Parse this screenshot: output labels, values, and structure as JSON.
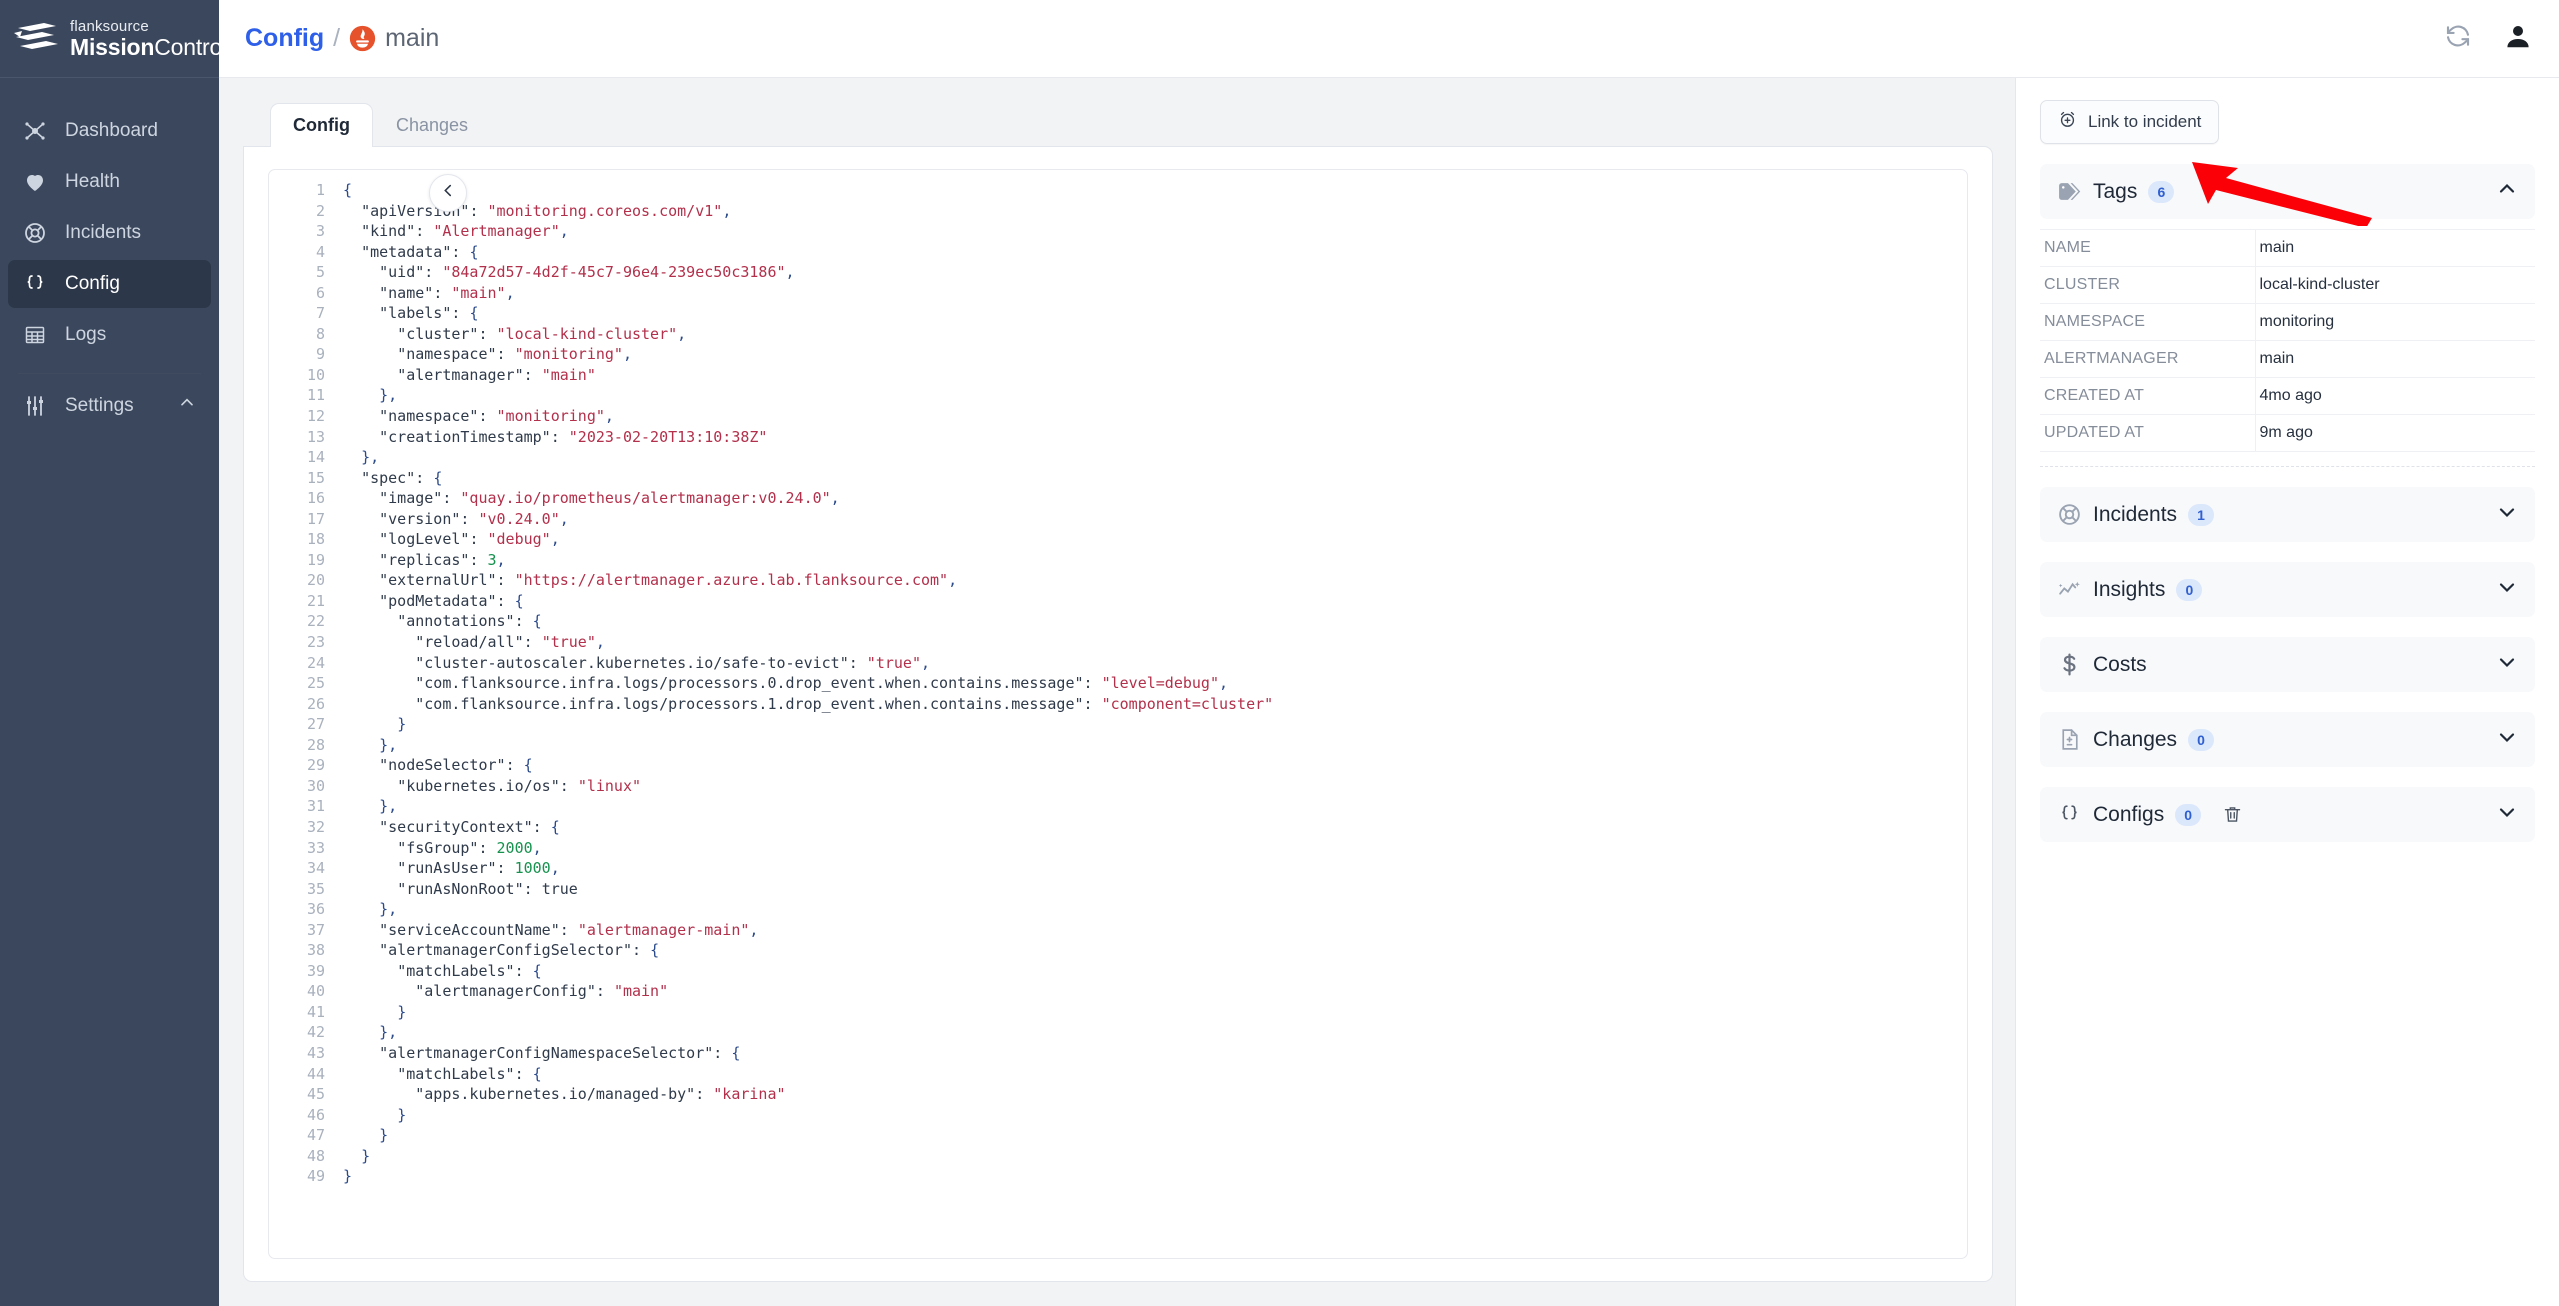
{
  "sidebar": {
    "logo": {
      "top": "flanksource",
      "bold": "Mission",
      "light": "Control",
      "icon": "flanksource-logo-icon"
    },
    "items": [
      {
        "label": "Dashboard",
        "icon": "topology-icon",
        "active": false
      },
      {
        "label": "Health",
        "icon": "heart-icon",
        "active": false
      },
      {
        "label": "Incidents",
        "icon": "lifebuoy-icon",
        "active": false
      },
      {
        "label": "Config",
        "icon": "braces-icon",
        "active": true
      },
      {
        "label": "Logs",
        "icon": "table-icon",
        "active": false
      }
    ],
    "settings": {
      "label": "Settings",
      "icon": "sliders-icon",
      "chevron": "chevron-up-icon"
    }
  },
  "header": {
    "breadcrumb_root": "Config",
    "breadcrumb_separator": "/",
    "breadcrumb_current": "main",
    "breadcrumb_icon": "prometheus-icon",
    "refresh_icon": "refresh-icon",
    "user_icon": "user-avatar-icon"
  },
  "content": {
    "collapse_icon": "chevron-left-icon",
    "tabs": [
      {
        "label": "Config",
        "active": true
      },
      {
        "label": "Changes",
        "active": false
      }
    ],
    "code_lines": [
      {
        "n": 1,
        "html": "<span class='k-brace'>{</span>"
      },
      {
        "n": 2,
        "html": "  <span class='k-key'>\"apiVersion\"</span>: <span class='k-str'>\"monitoring.coreos.com/v1\"</span><span class='k-punc'>,</span>"
      },
      {
        "n": 3,
        "html": "  <span class='k-key'>\"kind\"</span>: <span class='k-str'>\"Alertmanager\"</span><span class='k-punc'>,</span>"
      },
      {
        "n": 4,
        "html": "  <span class='k-key'>\"metadata\"</span>: <span class='k-brace'>{</span>"
      },
      {
        "n": 5,
        "html": "    <span class='k-key'>\"uid\"</span>: <span class='k-str'>\"84a72d57-4d2f-45c7-96e4-239ec50c3186\"</span><span class='k-punc'>,</span>"
      },
      {
        "n": 6,
        "html": "    <span class='k-key'>\"name\"</span>: <span class='k-str'>\"main\"</span><span class='k-punc'>,</span>"
      },
      {
        "n": 7,
        "html": "    <span class='k-key'>\"labels\"</span>: <span class='k-brace'>{</span>"
      },
      {
        "n": 8,
        "html": "      <span class='k-key'>\"cluster\"</span>: <span class='k-str'>\"local-kind-cluster\"</span><span class='k-punc'>,</span>"
      },
      {
        "n": 9,
        "html": "      <span class='k-key'>\"namespace\"</span>: <span class='k-str'>\"monitoring\"</span><span class='k-punc'>,</span>"
      },
      {
        "n": 10,
        "html": "      <span class='k-key'>\"alertmanager\"</span>: <span class='k-str'>\"main\"</span>"
      },
      {
        "n": 11,
        "html": "    <span class='k-brace'>}</span><span class='k-punc'>,</span>"
      },
      {
        "n": 12,
        "html": "    <span class='k-key'>\"namespace\"</span>: <span class='k-str'>\"monitoring\"</span><span class='k-punc'>,</span>"
      },
      {
        "n": 13,
        "html": "    <span class='k-key'>\"creationTimestamp\"</span>: <span class='k-str'>\"2023-02-20T13:10:38Z\"</span>"
      },
      {
        "n": 14,
        "html": "  <span class='k-brace'>}</span><span class='k-punc'>,</span>"
      },
      {
        "n": 15,
        "html": "  <span class='k-key'>\"spec\"</span>: <span class='k-brace'>{</span>"
      },
      {
        "n": 16,
        "html": "    <span class='k-key'>\"image\"</span>: <span class='k-str'>\"quay.io/prometheus/alertmanager:v0.24.0\"</span><span class='k-punc'>,</span>"
      },
      {
        "n": 17,
        "html": "    <span class='k-key'>\"version\"</span>: <span class='k-str'>\"v0.24.0\"</span><span class='k-punc'>,</span>"
      },
      {
        "n": 18,
        "html": "    <span class='k-key'>\"logLevel\"</span>: <span class='k-str'>\"debug\"</span><span class='k-punc'>,</span>"
      },
      {
        "n": 19,
        "html": "    <span class='k-key'>\"replicas\"</span>: <span class='k-num'>3</span><span class='k-punc'>,</span>"
      },
      {
        "n": 20,
        "html": "    <span class='k-key'>\"externalUrl\"</span>: <span class='k-str'>\"https://alertmanager.azure.lab.flanksource.com\"</span><span class='k-punc'>,</span>"
      },
      {
        "n": 21,
        "html": "    <span class='k-key'>\"podMetadata\"</span>: <span class='k-brace'>{</span>"
      },
      {
        "n": 22,
        "html": "      <span class='k-key'>\"annotations\"</span>: <span class='k-brace'>{</span>"
      },
      {
        "n": 23,
        "html": "        <span class='k-key'>\"reload/all\"</span>: <span class='k-str'>\"true\"</span><span class='k-punc'>,</span>"
      },
      {
        "n": 24,
        "html": "        <span class='k-key'>\"cluster-autoscaler.kubernetes.io/safe-to-evict\"</span>: <span class='k-str'>\"true\"</span><span class='k-punc'>,</span>"
      },
      {
        "n": 25,
        "html": "        <span class='k-key'>\"com.flanksource.infra.logs/processors.0.drop_event.when.contains.message\"</span>: <span class='k-str'>\"level=debug\"</span><span class='k-punc'>,</span>"
      },
      {
        "n": 26,
        "html": "        <span class='k-key'>\"com.flanksource.infra.logs/processors.1.drop_event.when.contains.message\"</span>: <span class='k-str'>\"component=cluster\"</span>"
      },
      {
        "n": 27,
        "html": "      <span class='k-brace'>}</span>"
      },
      {
        "n": 28,
        "html": "    <span class='k-brace'>}</span><span class='k-punc'>,</span>"
      },
      {
        "n": 29,
        "html": "    <span class='k-key'>\"nodeSelector\"</span>: <span class='k-brace'>{</span>"
      },
      {
        "n": 30,
        "html": "      <span class='k-key'>\"kubernetes.io/os\"</span>: <span class='k-str'>\"linux\"</span>"
      },
      {
        "n": 31,
        "html": "    <span class='k-brace'>}</span><span class='k-punc'>,</span>"
      },
      {
        "n": 32,
        "html": "    <span class='k-key'>\"securityContext\"</span>: <span class='k-brace'>{</span>"
      },
      {
        "n": 33,
        "html": "      <span class='k-key'>\"fsGroup\"</span>: <span class='k-num'>2000</span><span class='k-punc'>,</span>"
      },
      {
        "n": 34,
        "html": "      <span class='k-key'>\"runAsUser\"</span>: <span class='k-num'>1000</span><span class='k-punc'>,</span>"
      },
      {
        "n": 35,
        "html": "      <span class='k-key'>\"runAsNonRoot\"</span>: <span class='k-bool'>true</span>"
      },
      {
        "n": 36,
        "html": "    <span class='k-brace'>}</span><span class='k-punc'>,</span>"
      },
      {
        "n": 37,
        "html": "    <span class='k-key'>\"serviceAccountName\"</span>: <span class='k-str'>\"alertmanager-main\"</span><span class='k-punc'>,</span>"
      },
      {
        "n": 38,
        "html": "    <span class='k-key'>\"alertmanagerConfigSelector\"</span>: <span class='k-brace'>{</span>"
      },
      {
        "n": 39,
        "html": "      <span class='k-key'>\"matchLabels\"</span>: <span class='k-brace'>{</span>"
      },
      {
        "n": 40,
        "html": "        <span class='k-key'>\"alertmanagerConfig\"</span>: <span class='k-str'>\"main\"</span>"
      },
      {
        "n": 41,
        "html": "      <span class='k-brace'>}</span>"
      },
      {
        "n": 42,
        "html": "    <span class='k-brace'>}</span><span class='k-punc'>,</span>"
      },
      {
        "n": 43,
        "html": "    <span class='k-key'>\"alertmanagerConfigNamespaceSelector\"</span>: <span class='k-brace'>{</span>"
      },
      {
        "n": 44,
        "html": "      <span class='k-key'>\"matchLabels\"</span>: <span class='k-brace'>{</span>"
      },
      {
        "n": 45,
        "html": "        <span class='k-key'>\"apps.kubernetes.io/managed-by\"</span>: <span class='k-str'>\"karina\"</span>"
      },
      {
        "n": 46,
        "html": "      <span class='k-brace'>}</span>"
      },
      {
        "n": 47,
        "html": "    <span class='k-brace'>}</span>"
      },
      {
        "n": 48,
        "html": "  <span class='k-brace'>}</span>"
      },
      {
        "n": 49,
        "html": "<span class='k-brace'>}</span>"
      }
    ]
  },
  "right_panel": {
    "link_button": {
      "label": "Link to incident",
      "icon": "alarm-plus-icon"
    },
    "annotation_arrow": {
      "color": "#fb0007",
      "direction": "left"
    },
    "sections": [
      {
        "key": "tags",
        "label": "Tags",
        "count": "6",
        "icon": "tag-icon",
        "expanded": true,
        "chevron": "chevron-up-icon"
      },
      {
        "key": "incidents",
        "label": "Incidents",
        "count": "1",
        "icon": "lifebuoy-icon",
        "expanded": false,
        "chevron": "chevron-down-icon"
      },
      {
        "key": "insights",
        "label": "Insights",
        "count": "0",
        "icon": "trending-icon",
        "expanded": false,
        "chevron": "chevron-down-icon"
      },
      {
        "key": "costs",
        "label": "Costs",
        "count": "",
        "icon": "dollar-icon",
        "expanded": false,
        "chevron": "chevron-down-icon"
      },
      {
        "key": "changes",
        "label": "Changes",
        "count": "0",
        "icon": "file-diff-icon",
        "expanded": false,
        "chevron": "chevron-down-icon"
      },
      {
        "key": "configs",
        "label": "Configs",
        "count": "0",
        "icon": "braces-icon",
        "expanded": false,
        "chevron": "chevron-down-icon",
        "trash": "trash-icon"
      }
    ],
    "tags_table": [
      {
        "name": "NAME",
        "value": "main"
      },
      {
        "name": "CLUSTER",
        "value": "local-kind-cluster"
      },
      {
        "name": "NAMESPACE",
        "value": "monitoring"
      },
      {
        "name": "ALERTMANAGER",
        "value": "main"
      },
      {
        "name": "CREATED AT",
        "value": "4mo ago"
      },
      {
        "name": "UPDATED AT",
        "value": "9m ago"
      }
    ]
  },
  "colors": {
    "sidebar_bg": "#3b475c",
    "sidebar_active": "#2c3749",
    "accent_blue": "#2e5fe8",
    "badge_bg": "#dbe7fb",
    "badge_text": "#2f5fd0",
    "prometheus_orange": "#e6522c",
    "annotation_red": "#fb0007",
    "page_bg": "#f1f3f5"
  }
}
